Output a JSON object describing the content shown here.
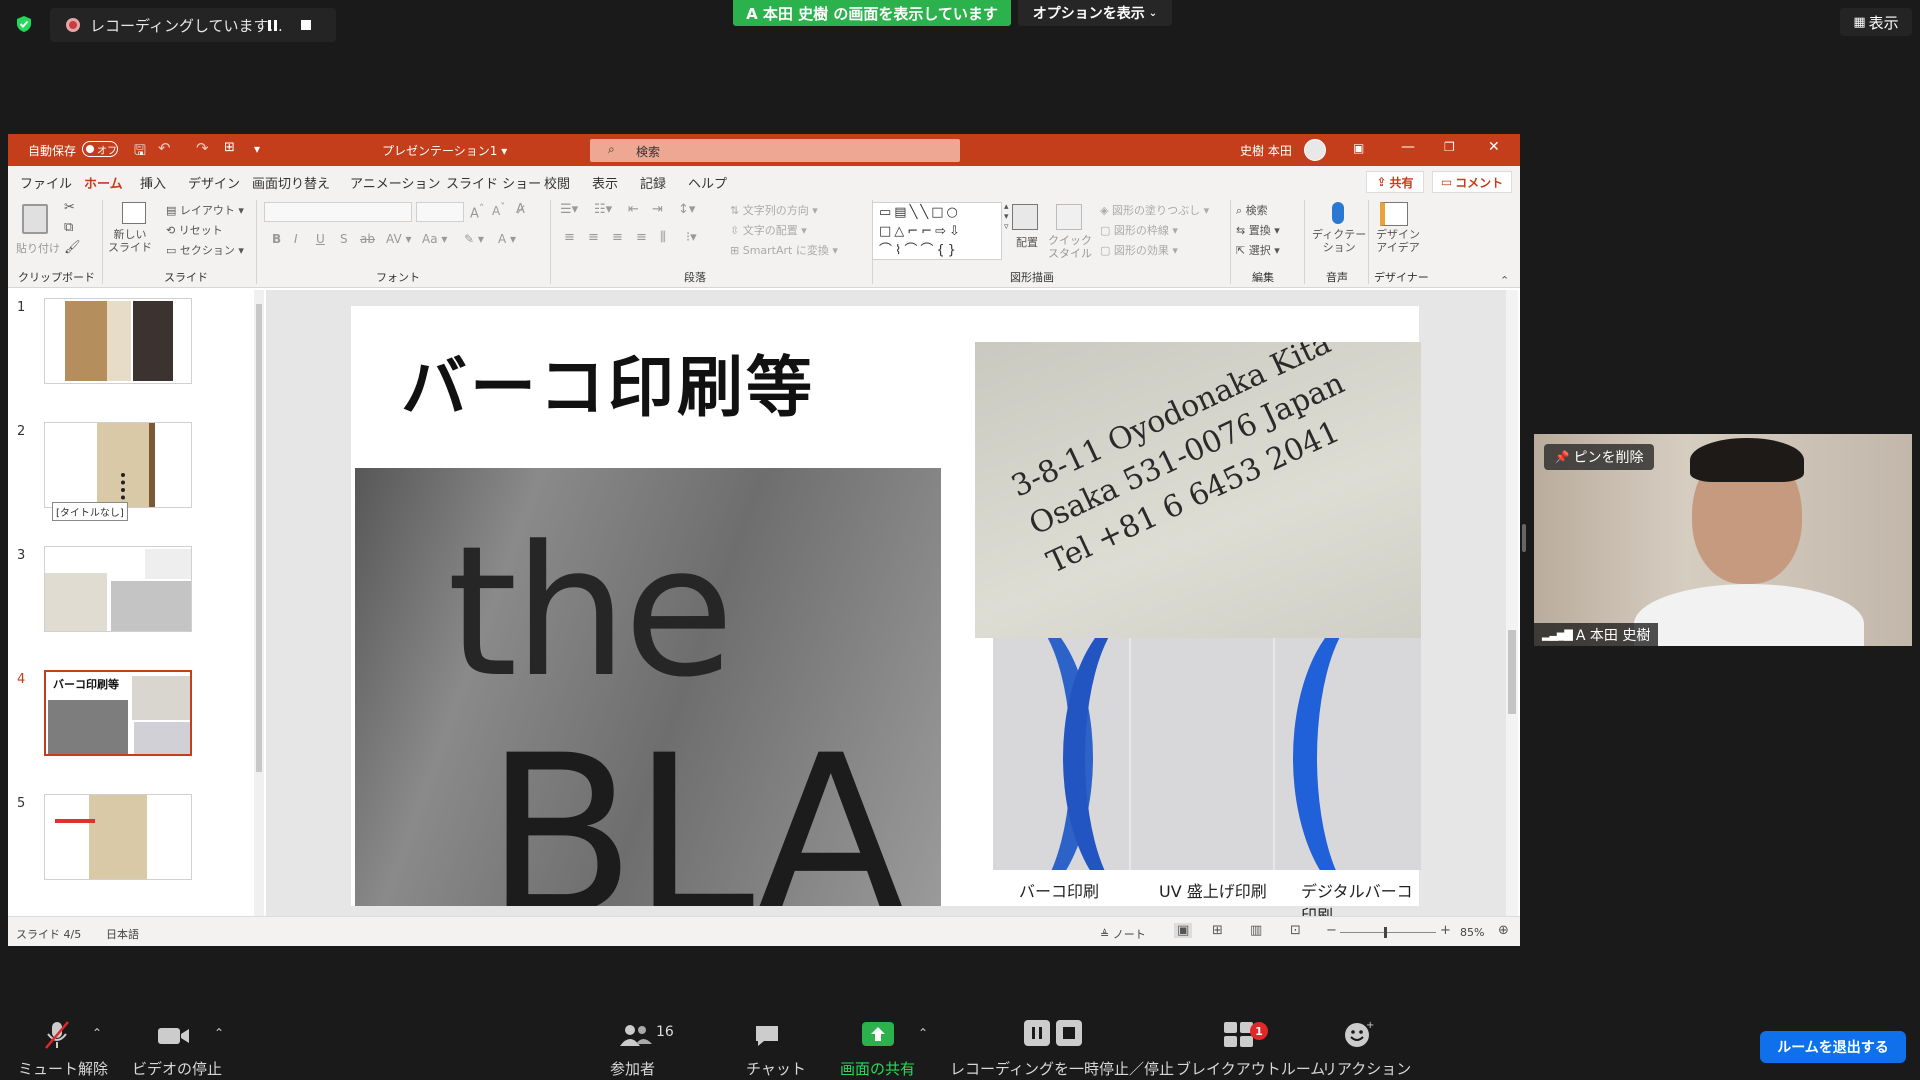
{
  "zoom": {
    "recording_label": "レコーディングしています...",
    "share_banner": "A 本田 史樹 の画面を表示しています",
    "options_label": "オプションを表示",
    "view_label": "表示",
    "unpin_label": "ピンを削除",
    "video_name": "A 本田 史樹",
    "bottom": {
      "mute": "ミュート解除",
      "video": "ビデオの停止",
      "participants": "参加者",
      "participants_count": "16",
      "chat": "チャット",
      "share": "画面の共有",
      "recording": "レコーディングを一時停止／停止",
      "breakout": "ブレイクアウトルーム",
      "breakout_badge": "1",
      "reaction": "リアクション",
      "leave": "ルームを退出する"
    },
    "accent_green": "#2bb24c",
    "accent_blue": "#0e71eb"
  },
  "ppt": {
    "autosave": "自動保存",
    "autosave_state": "オフ",
    "doc_title": "プレゼンテーション1",
    "search_placeholder": "検索",
    "user": "史樹 本田",
    "menu": [
      "ファイル",
      "ホーム",
      "挿入",
      "デザイン",
      "画面切り替え",
      "アニメーション",
      "スライド ショー",
      "校閲",
      "表示",
      "記録",
      "ヘルプ"
    ],
    "share": "共有",
    "comment": "コメント",
    "ribbon": {
      "paste": "貼り付け",
      "clipboard": "クリップボード",
      "new_slide": "新しい\nスライド",
      "layout": "レイアウト",
      "reset": "リセット",
      "section": "セクション",
      "slide_group": "スライド",
      "font_group": "フォント",
      "paragraph_group": "段落",
      "text_direction": "文字列の方向",
      "text_align": "文字の配置",
      "smartart": "SmartArt に変換",
      "arrange": "配置",
      "quick_style": "クイック\nスタイル",
      "shape_fill": "図形の塗りつぶし",
      "shape_outline": "図形の枠線",
      "shape_effect": "図形の効果",
      "drawing_group": "図形描画",
      "find": "検索",
      "replace": "置換",
      "select": "選択",
      "editing_group": "編集",
      "dictate": "ディクテー\nション",
      "voice_group": "音声",
      "design_ideas": "デザイン\nアイデア",
      "designer_group": "デザイナー"
    },
    "thumbs": [
      {
        "num": "1"
      },
      {
        "num": "2",
        "tooltip": "[タイトルなし]"
      },
      {
        "num": "3"
      },
      {
        "num": "4",
        "title": "バーコ印刷等"
      },
      {
        "num": "5"
      }
    ],
    "slide": {
      "title": "バーコ印刷等",
      "card_text": [
        "3-8-11 Oyodonaka Kita",
        "Osaka 531-0076 Japan",
        "Tel +81 6 6453 2041"
      ],
      "photo_text": [
        "the",
        "BLA"
      ],
      "captions": [
        "バーコ印刷",
        "UV 盛上げ印刷",
        "デジタルバーコ印刷"
      ]
    },
    "status": {
      "slide_info": "スライド 4/5",
      "language": "日本語",
      "notes": "ノート",
      "zoom": "85%"
    },
    "accent": "#c43e1c"
  }
}
